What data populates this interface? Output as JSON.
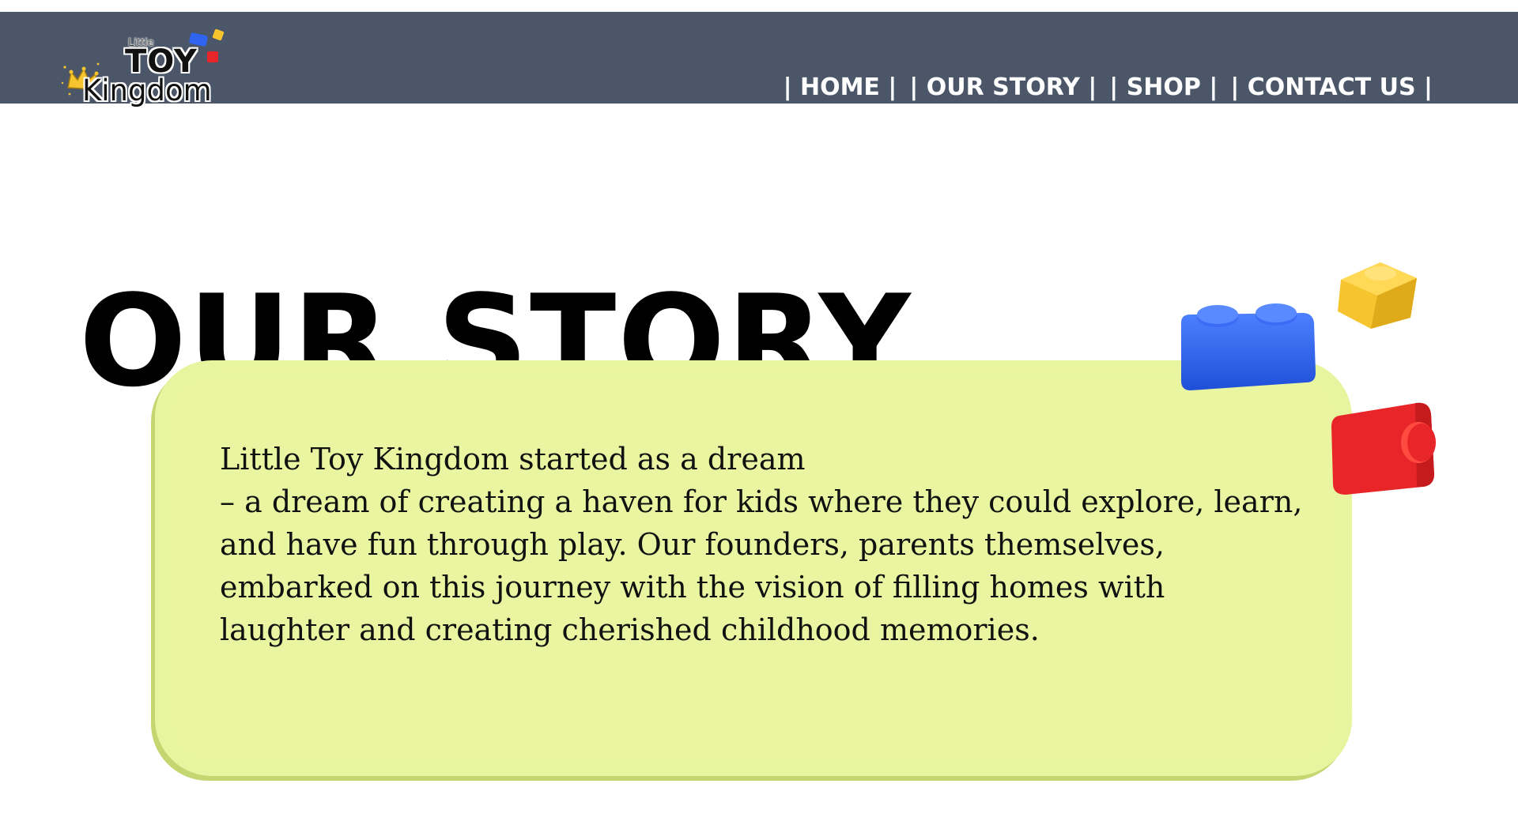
{
  "brand": {
    "logo_little": "Little",
    "logo_toy": "TOY",
    "logo_kingdom": "Kingdom"
  },
  "nav": {
    "items": [
      {
        "label": "| HOME |"
      },
      {
        "label": "| OUR STORY |"
      },
      {
        "label": "| SHOP |"
      },
      {
        "label": "| CONTACT US |"
      }
    ]
  },
  "page": {
    "title": "OUR STORY"
  },
  "story": {
    "text": "Little Toy Kingdom started as a dream\n– a dream of creating a haven for kids where they could explore, learn,\n and have fun through play. Our founders, parents themselves,\n embarked on this journey with the vision of filling homes with\nlaughter and creating cherished childhood memories."
  },
  "colors": {
    "header_bg": "#4b5768",
    "card_bg": "#e9f5a0",
    "brick_blue": "#2f64f0",
    "brick_yellow": "#f5c42e",
    "brick_red": "#e8262a"
  },
  "icons": [
    "crown-icon",
    "blue-brick-icon",
    "yellow-brick-icon",
    "red-brick-icon"
  ]
}
